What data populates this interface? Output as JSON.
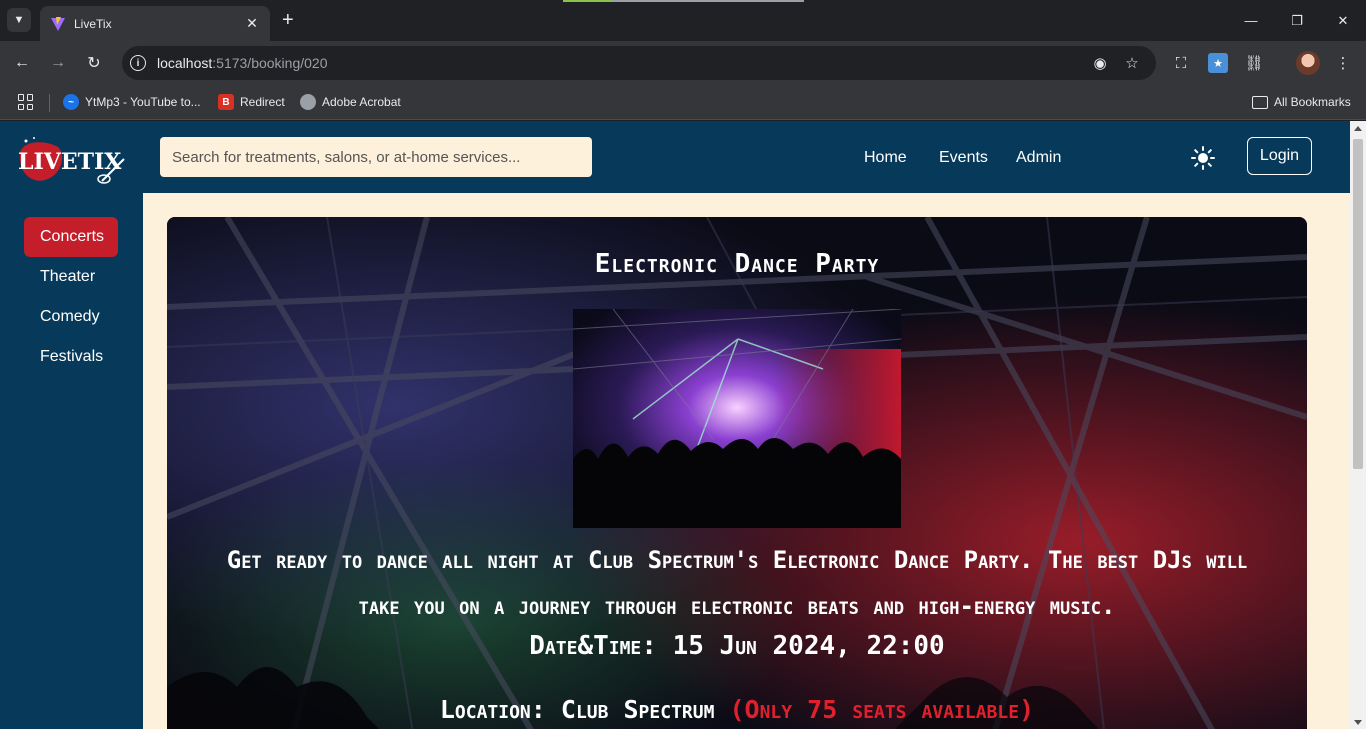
{
  "browser": {
    "tab_title": "LiveTix",
    "url_host": "localhost",
    "url_path": ":5173/booking/020",
    "bookmarks": [
      {
        "label": "YtMp3 - YouTube to..."
      },
      {
        "label": "Redirect"
      },
      {
        "label": "Adobe Acrobat"
      }
    ],
    "all_bookmarks": "All Bookmarks"
  },
  "header": {
    "logo_text": "LIVETIX",
    "search_placeholder": "Search for treatments, salons, or at-home services...",
    "nav": [
      "Home",
      "Events",
      "Admin"
    ],
    "login_label": "Login"
  },
  "sidebar": {
    "items": [
      {
        "label": "Concerts",
        "active": true
      },
      {
        "label": "Theater",
        "active": false
      },
      {
        "label": "Comedy",
        "active": false
      },
      {
        "label": "Festivals",
        "active": false
      }
    ]
  },
  "event": {
    "title": "Electronic Dance Party",
    "description": "Get ready to dance all night at Club Spectrum's Electronic Dance Party. The best DJs will take you on a journey through electronic beats and high-energy music.",
    "date_label": "Date&Time:",
    "date_value": "15 Jun 2024, 22:00",
    "location_label": "Location:",
    "location_value": "Club Spectrum",
    "seats_text": "(Only 75 seats available)"
  },
  "colors": {
    "header_bg": "#073a5a",
    "page_bg": "#fdf1dc",
    "accent_red": "#c41e2b"
  }
}
